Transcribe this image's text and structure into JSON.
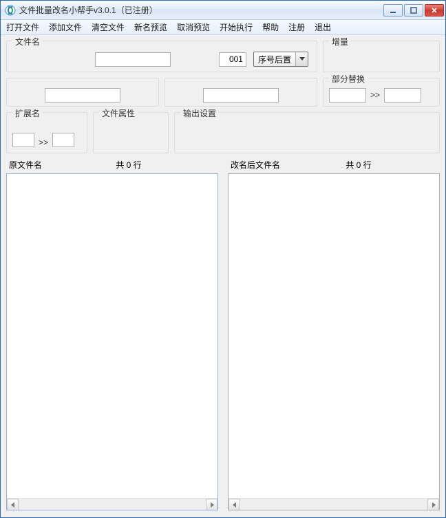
{
  "title": "文件批量改名小帮手v3.0.1（已注册）",
  "menu": {
    "open_file": "打开文件",
    "add_file": "添加文件",
    "clear_files": "清空文件",
    "preview_new": "新名预览",
    "cancel_preview": "取消预览",
    "start_exec": "开始执行",
    "help": "帮助",
    "register": "注册",
    "exit": "退出"
  },
  "groups": {
    "filename": "文件名",
    "increment": "增量",
    "partial_replace": "部分替换",
    "extension": "扩展名",
    "attributes": "文件属性",
    "output": "输出设置"
  },
  "fields": {
    "filename_value": "",
    "seq_number": "001",
    "seq_mode_selected": "序号后置",
    "blank1_value": "",
    "blank2_value": "",
    "replace_from": "",
    "replace_to": "",
    "replace_arrow": ">>",
    "ext_from": "",
    "ext_to": "",
    "ext_arrow": ">>"
  },
  "lists": {
    "original_label": "原文件名",
    "renamed_label": "改名后文件名",
    "original_count": "共 0 行",
    "renamed_count": "共 0 行"
  }
}
